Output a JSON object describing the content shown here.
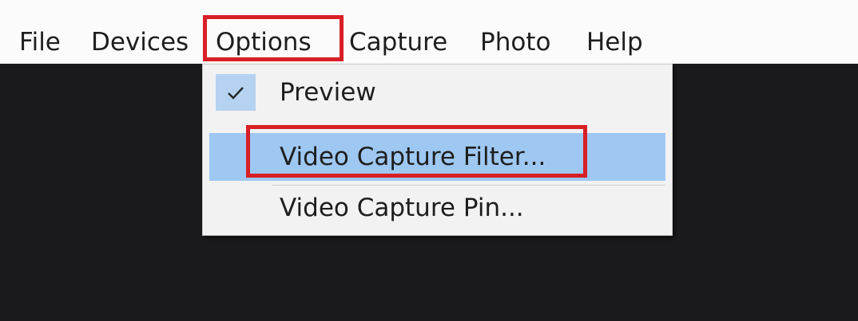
{
  "menubar": {
    "items": [
      {
        "label": "File"
      },
      {
        "label": "Devices"
      },
      {
        "label": "Options"
      },
      {
        "label": "Capture"
      },
      {
        "label": "Photo"
      },
      {
        "label": "Help"
      }
    ]
  },
  "options_menu": {
    "items": [
      {
        "label": "Preview",
        "checked": true
      },
      {
        "label": "Video Capture Filter...",
        "highlighted": true
      },
      {
        "label": "Video Capture Pin..."
      }
    ]
  },
  "annotation": {
    "color": "#d81f26"
  },
  "colors": {
    "selection": "#9ec8f2",
    "check_background": "#b5d3f1",
    "menu_background": "#f2f2f2",
    "video_background": "#1a1a1c"
  },
  "icons": {
    "check": "check-icon"
  }
}
